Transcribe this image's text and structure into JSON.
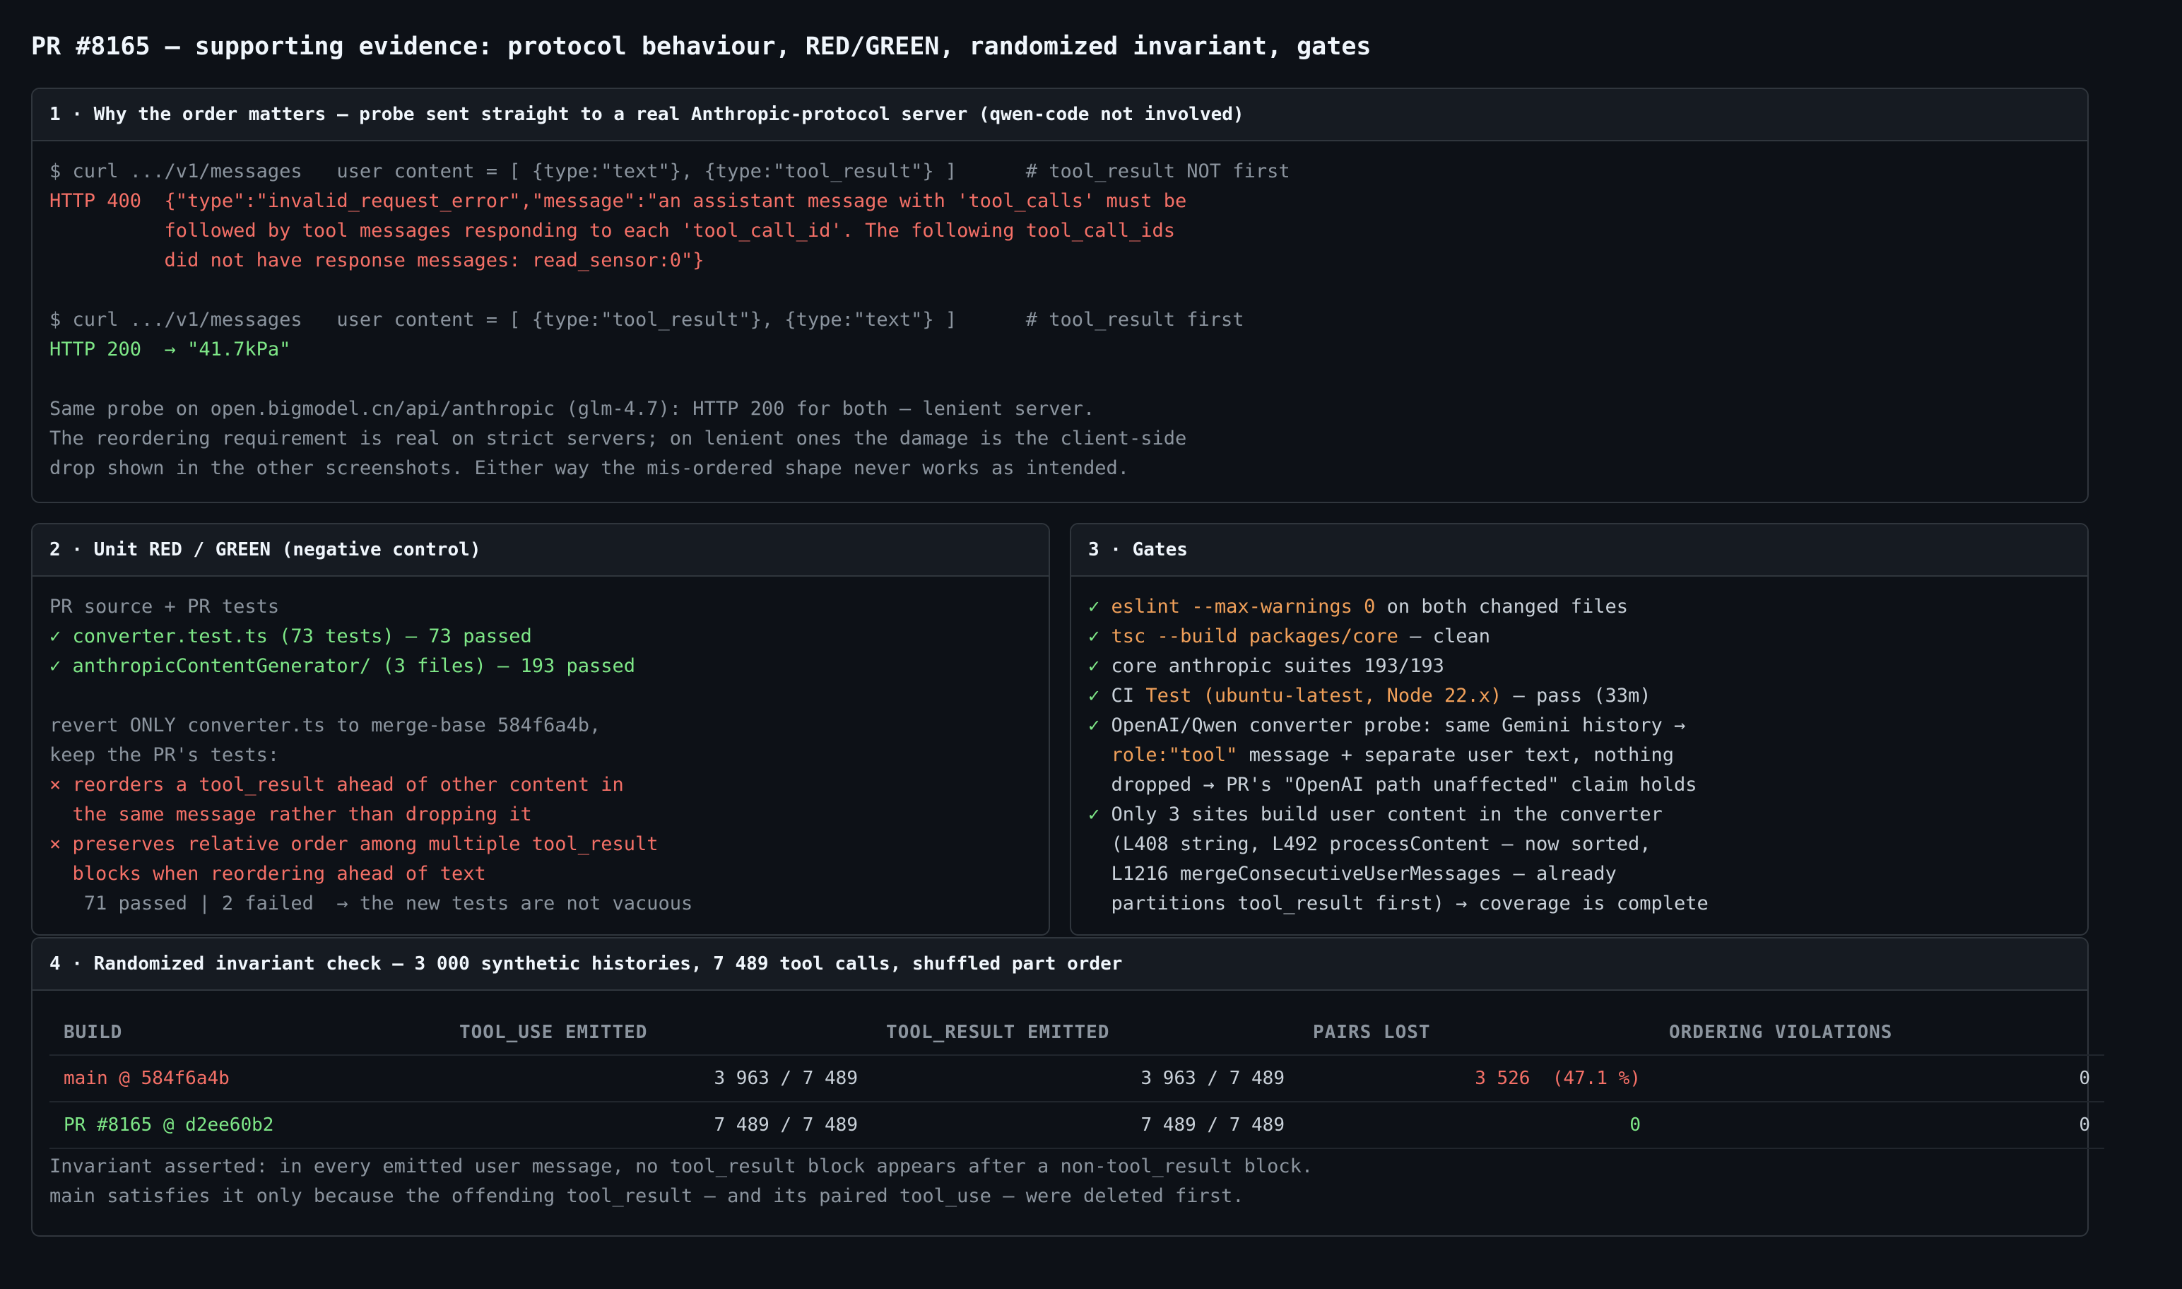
{
  "title": "PR #8165 — supporting evidence: protocol behaviour, RED/GREEN, randomized invariant, gates",
  "panel1": {
    "heading": "1 · Why the order matters — probe sent straight to a real Anthropic-protocol server (qwen-code not involved)",
    "lines": [
      {
        "text": "$ curl .../v1/messages   user content = [ {type:\"text\"}, {type:\"tool_result\"} ]      # tool_result NOT first",
        "color": "gray"
      },
      {
        "text": "HTTP 400  {\"type\":\"invalid_request_error\",\"message\":\"an assistant message with 'tool_calls' must be",
        "color": "red"
      },
      {
        "text": "          followed by tool messages responding to each 'tool_call_id'. The following tool_call_ids",
        "color": "red"
      },
      {
        "text": "          did not have response messages: read_sensor:0\"}",
        "color": "red"
      },
      {
        "text": "",
        "color": "gray"
      },
      {
        "text": "$ curl .../v1/messages   user content = [ {type:\"tool_result\"}, {type:\"text\"} ]      # tool_result first",
        "color": "gray"
      },
      {
        "text": "HTTP 200  → \"41.7kPa\"",
        "color": "green"
      },
      {
        "text": "",
        "color": "gray"
      },
      {
        "text": "Same probe on open.bigmodel.cn/api/anthropic (glm-4.7): HTTP 200 for both — lenient server.",
        "color": "gray"
      },
      {
        "text": "The reordering requirement is real on strict servers; on lenient ones the damage is the client-side",
        "color": "gray"
      },
      {
        "text": "drop shown in the other screenshots. Either way the mis-ordered shape never works as intended.",
        "color": "gray"
      }
    ]
  },
  "panel2": {
    "heading": "2 · Unit RED / GREEN (negative control)",
    "lines": [
      {
        "text": "PR source + PR tests",
        "color": "gray"
      },
      {
        "text": "✓ converter.test.ts (73 tests) — 73 passed",
        "color": "green"
      },
      {
        "text": "✓ anthropicContentGenerator/ (3 files) — 193 passed",
        "color": "green"
      },
      {
        "text": "",
        "color": "gray"
      },
      {
        "text": "revert ONLY converter.ts to merge-base 584f6a4b,",
        "color": "gray"
      },
      {
        "text": "keep the PR's tests:",
        "color": "gray"
      },
      {
        "text": "× reorders a tool_result ahead of other content in",
        "color": "red"
      },
      {
        "text": "  the same message rather than dropping it",
        "color": "red"
      },
      {
        "text": "× preserves relative order among multiple tool_result",
        "color": "red"
      },
      {
        "text": "  blocks when reordering ahead of text",
        "color": "red"
      },
      {
        "text": "   71 passed | 2 failed  → the new tests are not vacuous",
        "color": "gray"
      }
    ]
  },
  "panel3": {
    "heading": "3 · Gates",
    "check": "✓",
    "line1_code": "eslint --max-warnings 0",
    "line1_rest": " on both changed files",
    "line2_code": "tsc --build packages/core",
    "line2_rest": " — clean",
    "line3_rest": "core anthropic suites 193/193",
    "line4_pre": "CI ",
    "line4_code": "Test (ubuntu-latest, Node 22.x)",
    "line4_rest": " — pass (33m)",
    "line5_rest": "OpenAI/Qwen converter probe: same Gemini history →",
    "line6_code": "role:\"tool\"",
    "line6_rest": " message + separate user text, nothing",
    "line7_rest": "dropped → PR's \"OpenAI path unaffected\" claim holds",
    "line8_rest": "Only 3 sites build user content in the converter",
    "line9_rest": "(L408 string, L492 processContent — now sorted,",
    "line10_rest": "L1216 mergeConsecutiveUserMessages — already",
    "line11_rest": "partitions tool_result first) → coverage is complete"
  },
  "panel4": {
    "heading": "4 · Randomized invariant check — 3 000 synthetic histories, 7 489 tool calls, shuffled part order",
    "columns": [
      "BUILD",
      "TOOL_USE EMITTED",
      "TOOL_RESULT EMITTED",
      "PAIRS LOST",
      "ORDERING VIOLATIONS"
    ],
    "rows": [
      {
        "build": "main @ 584f6a4b",
        "tool_use": "3 963 / 7 489",
        "tool_result": "3 963 / 7 489",
        "pairs_lost": "3 526  (47.1 %)",
        "violations": "0",
        "color": "red"
      },
      {
        "build": "PR #8165 @ d2ee60b2",
        "tool_use": "7 489 / 7 489",
        "tool_result": "7 489 / 7 489",
        "pairs_lost": "0",
        "violations": "0",
        "color": "green"
      }
    ],
    "footnote": [
      "Invariant asserted: in every emitted user message, no tool_result block appears after a non-tool_result block.",
      "main satisfies it only because the offending tool_result — and its paired tool_use — were deleted first."
    ]
  },
  "colors": {
    "background": "#0d1117",
    "panel_header": "#161b22",
    "border": "#30363d",
    "red": "#f47067",
    "green": "#7ee787",
    "orange": "#f0a05a",
    "gray": "#8b949e"
  }
}
